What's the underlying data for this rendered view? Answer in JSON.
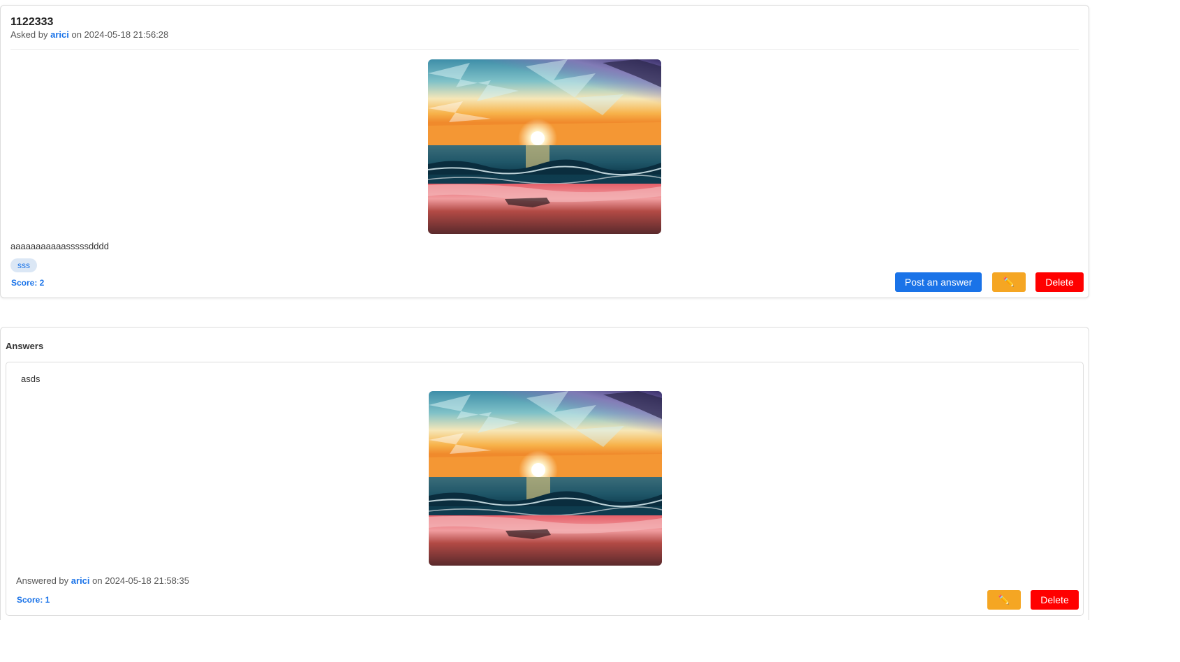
{
  "question": {
    "title": "1122333",
    "asked_by_prefix": "Asked by",
    "author": "arici",
    "date_text": "on 2024-05-18 21:56:28",
    "image_alt": "Sunset over the ocean painting",
    "body": "aaaaaaaaaaasssssdddd",
    "tags": [
      "sss"
    ],
    "score_text": "Score: 2",
    "buttons": {
      "post_answer": "Post an answer",
      "edit_icon": "pencil-icon",
      "delete": "Delete"
    }
  },
  "answers": {
    "heading": "Answers",
    "items": [
      {
        "body": "asds",
        "image_alt": "Sunset over the ocean painting",
        "answered_by_prefix": "Answered by",
        "author": "arici",
        "date_text": "on 2024-05-18 21:58:35",
        "score_text": "Score: 1",
        "buttons": {
          "edit_icon": "pencil-icon",
          "delete": "Delete"
        }
      }
    ]
  },
  "colors": {
    "accent_blue": "#1a73e8",
    "edit_orange": "#f5a623",
    "delete_red": "#ff0000",
    "tag_bg": "#dbe7f5"
  }
}
